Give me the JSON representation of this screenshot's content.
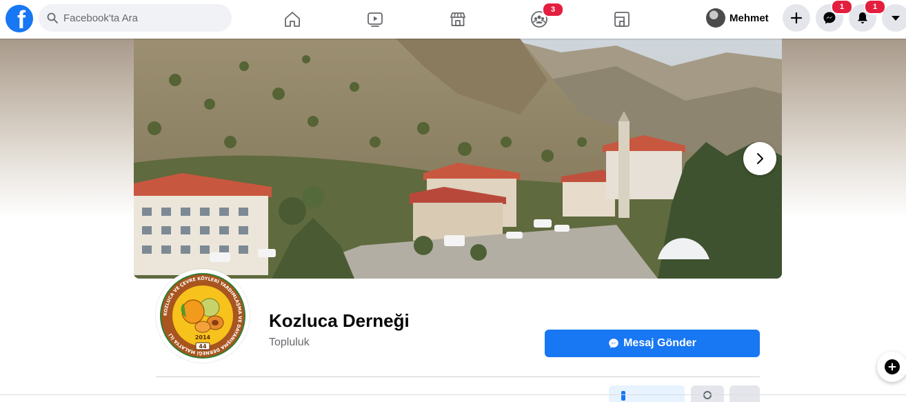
{
  "topbar": {
    "search_placeholder": "Facebook'ta Ara",
    "groups_badge": "3",
    "profile_name": "Mehmet",
    "messenger_badge": "1",
    "notifications_badge": "1"
  },
  "page": {
    "name": "Kozluca Derneği",
    "category": "Topluluk",
    "message_button": "Mesaj Gönder"
  },
  "logo_text": {
    "year": "2014",
    "plate": "44",
    "ring_text": "KOZLUCA VE ÇEVRE KÖYLERİ YARDIMLAŞMA VE DAYANIŞMA DERNEĞİ MALATYA İLİ"
  },
  "colors": {
    "brand": "#1877f2",
    "badge": "#e41e3f",
    "text_primary": "#050505",
    "text_secondary": "#65676b"
  },
  "icons": [
    "facebook-logo-icon",
    "search-icon",
    "home-icon",
    "watch-icon",
    "marketplace-icon",
    "groups-icon",
    "gaming-icon",
    "plus-icon",
    "messenger-icon",
    "bell-icon",
    "caret-down-icon",
    "chevron-right-icon"
  ]
}
